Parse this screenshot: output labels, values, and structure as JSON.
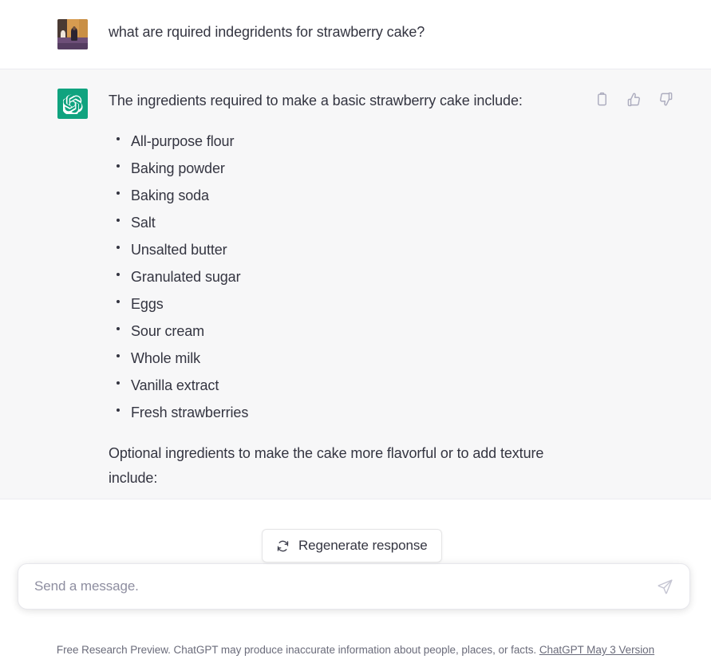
{
  "app": {
    "title": "ChatGPT"
  },
  "messages": [
    {
      "role": "user",
      "avatar_icon": "user-photo-avatar",
      "text": "what are rquired indegridents for strawberry cake?"
    },
    {
      "role": "assistant",
      "avatar_icon": "openai-logo-icon",
      "intro": "The ingredients required to make a basic strawberry cake include:",
      "ingredients": [
        "All-purpose flour",
        "Baking powder",
        "Baking soda",
        "Salt",
        "Unsalted butter",
        "Granulated sugar",
        "Eggs",
        "Sour cream",
        "Whole milk",
        "Vanilla extract",
        "Fresh strawberries"
      ],
      "outro": "Optional ingredients to make the cake more flavorful or to add texture include:"
    }
  ],
  "message_actions": [
    {
      "name": "copy-icon",
      "label": "Copy"
    },
    {
      "name": "thumbs-up-icon",
      "label": "Good response"
    },
    {
      "name": "thumbs-down-icon",
      "label": "Bad response"
    }
  ],
  "regenerate": {
    "label": "Regenerate response",
    "icon": "refresh-icon"
  },
  "composer": {
    "placeholder": "Send a message.",
    "value": "",
    "send_icon": "send-paper-plane-icon"
  },
  "footer": {
    "disclaimer": "Free Research Preview. ChatGPT may produce inaccurate information about people, places, or facts.",
    "version_link": "ChatGPT May 3 Version"
  },
  "colors": {
    "brand_green": "#10a37f",
    "assistant_bg": "#f7f7f8",
    "user_bg": "#ffffff",
    "text": "#343541",
    "muted": "#8e8ea0",
    "icon": "#acacbe"
  }
}
